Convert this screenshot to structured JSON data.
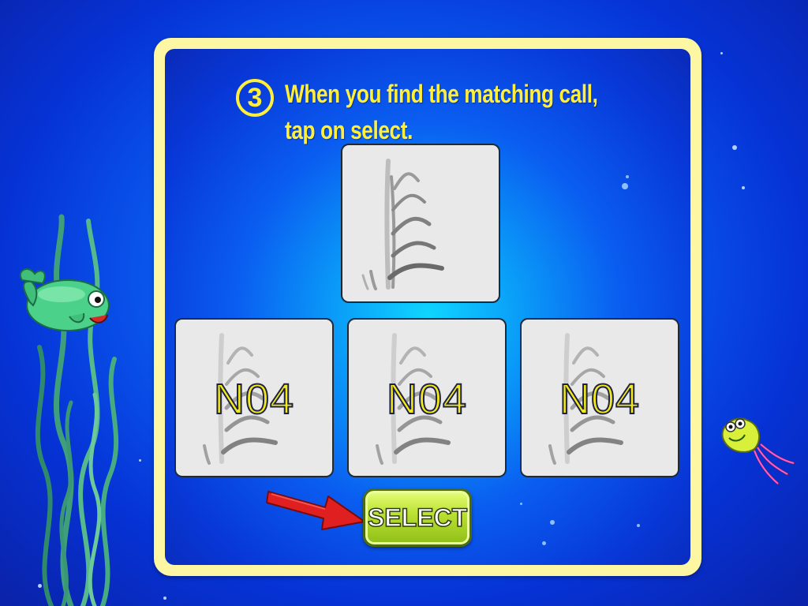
{
  "step": {
    "number": "3",
    "instruction_line1": "When you find the matching call,",
    "instruction_line2": "tap on select."
  },
  "reference_tile": {
    "icon": "spectrogram-icon"
  },
  "options": [
    {
      "label": "N04",
      "icon": "spectrogram-icon"
    },
    {
      "label": "N04",
      "icon": "spectrogram-icon"
    },
    {
      "label": "N04",
      "icon": "spectrogram-icon"
    }
  ],
  "select_button": {
    "label": "SELECT"
  },
  "colors": {
    "ocean_blue": "#0633d6",
    "panel_border": "#fdf6a3",
    "instruction_text": "#ffee3a",
    "select_green": "#b8e02f",
    "arrow_red": "#e02020"
  }
}
